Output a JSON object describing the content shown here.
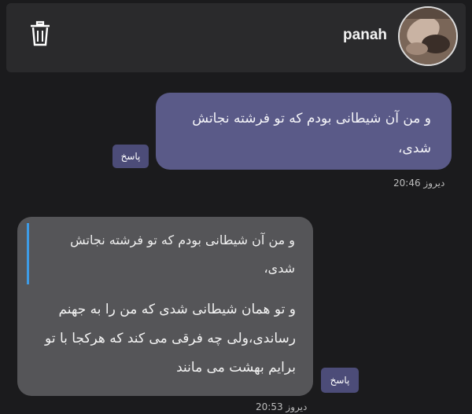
{
  "header": {
    "username": "panah",
    "trash_icon": "trash-icon",
    "avatar_icon": "user-avatar"
  },
  "messages": [
    {
      "direction": "outgoing",
      "text": "و من آن شیطانی بودم که تو فرشته نجاتش شدی،",
      "reply_label": "پاسخ",
      "timestamp": "دیروز 20:46"
    },
    {
      "direction": "incoming",
      "quoted": "و من آن شیطانی بودم که تو فرشته نجاتش شدی،",
      "text": "و تو همان شیطانی شدی که من را به جهنم رساندی،ولی چه فرقی می کند که هرکجا با تو برایم بهشت می مانند",
      "reply_label": "پاسخ",
      "timestamp": "دیروز 20:53"
    }
  ],
  "colors": {
    "background": "#1b1b1d",
    "header": "#2a2a2c",
    "outgoing_bubble": "#5a5a88",
    "incoming_bubble": "#555558",
    "quote_bar": "#3d9be6",
    "reply_button": "#4c4c78"
  }
}
